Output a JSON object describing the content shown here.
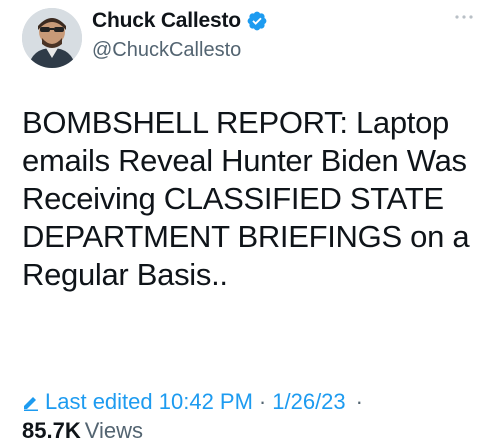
{
  "author": {
    "display_name": "Chuck Callesto",
    "handle": "@ChuckCallesto",
    "verified": true,
    "avatar_icon": "profile-photo"
  },
  "tweet": {
    "text": "BOMBSHELL REPORT: Laptop emails Reveal Hunter Biden Was Receiving CLASSIFIED STATE DEPARTMENT BRIEFINGS on a Regular Basis.."
  },
  "meta": {
    "edit_label": "Last edited 10:42 PM",
    "separator": "·",
    "edit_date": "1/26/23",
    "trailing_separator": "·",
    "views_count": "85.7K",
    "views_label": "Views"
  },
  "icons": {
    "verified": "verified-badge-icon",
    "more": "more-options-icon",
    "edit": "pencil-icon"
  },
  "colors": {
    "accent": "#1d9bf0",
    "text_primary": "#0f1419",
    "text_secondary": "#536471"
  }
}
